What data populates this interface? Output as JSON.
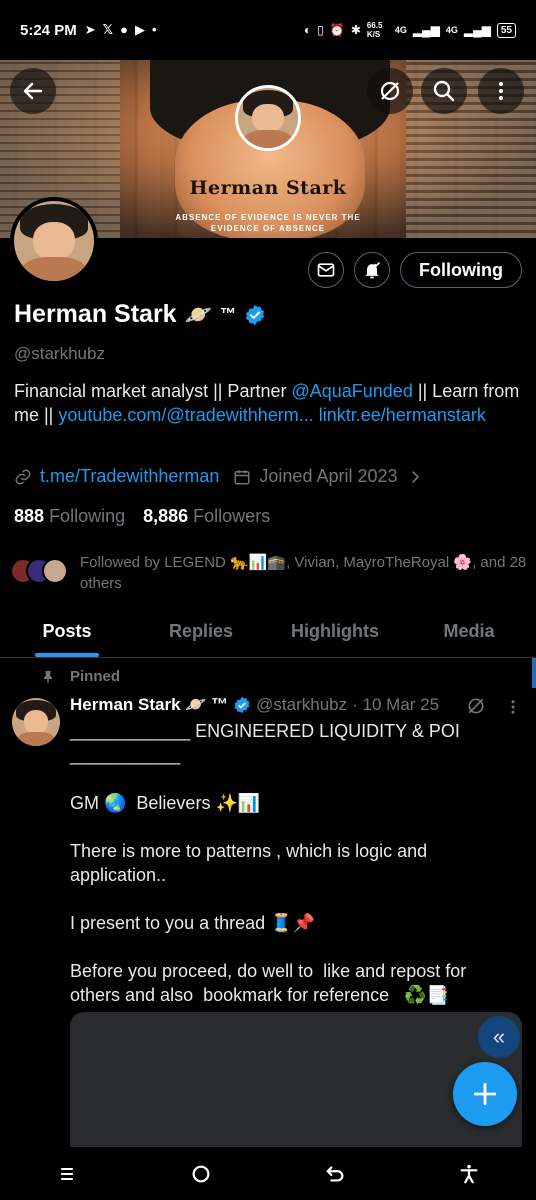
{
  "status_bar": {
    "time": "5:24 PM",
    "left_icons": [
      "telegram-icon",
      "x-icon",
      "chat-icon",
      "youtube-icon",
      "dot-icon"
    ],
    "net_speed": "66.5 K/S",
    "network_1": "4G",
    "network_2": "4G",
    "battery": "55"
  },
  "banner": {
    "title": "Herman Stark",
    "subtitle_line1": "ABSENCE OF EVIDENCE IS NEVER THE",
    "subtitle_line2": "EVIDENCE OF ABSENCE"
  },
  "profile": {
    "name": "Herman Stark",
    "name_emoji": "🪐",
    "tm": "™",
    "handle": "@starkhubz",
    "bio_prefix": "Financial market analyst || Partner ",
    "bio_mention": "@AquaFunded",
    "bio_mid": " || Learn from me || ",
    "bio_link1": "youtube.com/@tradewithherm...",
    "bio_space": " ",
    "bio_link2": "linktr.ee/hermanstark",
    "website": "t.me/Tradewithherman",
    "joined": "Joined April 2023",
    "following_count": "888",
    "following_label": "Following",
    "followers_count": "8,886",
    "followers_label": "Followers",
    "followed_by": "Followed by LEGEND 🐆📊🕋, Vivian, MayroTheRoyal 🌸, and 28 others",
    "follow_button": "Following"
  },
  "tabs": [
    "Posts",
    "Replies",
    "Highlights",
    "Media"
  ],
  "post": {
    "pinned_label": "Pinned",
    "author_name": "Herman Stark 🪐 ™",
    "author_handle": "@starkhubz",
    "date": "· 10 Mar 25",
    "body": "____________ ENGINEERED LIQUIDITY & POI\n___________\n\nGM 🌏  Believers ✨📊\n\nThere is more to patterns , which is logic and application..\n\nI present to you a thread 🧵📌\n\nBefore you proceed, do well to  like and repost for others and also  bookmark for reference   ♻️📑"
  },
  "colors": {
    "accent": "#1d9bf0",
    "muted": "#71767b",
    "background": "#000000"
  }
}
